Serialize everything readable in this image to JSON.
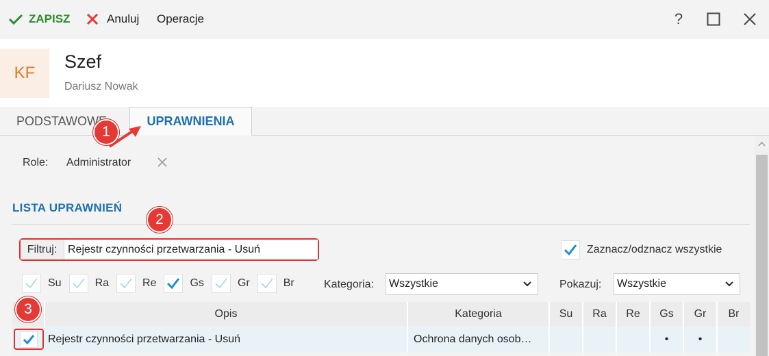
{
  "toolbar": {
    "save_label": "ZAPISZ",
    "cancel_label": "Anuluj",
    "operations_label": "Operacje"
  },
  "window": {
    "help": "?"
  },
  "header": {
    "initials": "KF",
    "title": "Szef",
    "name": "Dariusz Nowak"
  },
  "tabs": [
    {
      "label": "PODSTAWOWE"
    },
    {
      "label": "UPRAWNIENIA",
      "active": true
    }
  ],
  "roles": {
    "label": "Role:",
    "value": "Administrator"
  },
  "section": {
    "title": "LISTA UPRAWNIEŃ"
  },
  "filter": {
    "label": "Filtruj:",
    "value": "Rejestr czynności przetwarzania - Usuń"
  },
  "select_all": {
    "label": "Zaznacz/odznacz wszystkie",
    "checked": true
  },
  "flags": [
    {
      "label": "Su",
      "checked": false
    },
    {
      "label": "Ra",
      "checked": false
    },
    {
      "label": "Re",
      "checked": false
    },
    {
      "label": "Gs",
      "checked": true
    },
    {
      "label": "Gr",
      "checked": false
    },
    {
      "label": "Br",
      "checked": false
    }
  ],
  "category_filter": {
    "label": "Kategoria:",
    "value": "Wszystkie"
  },
  "show_filter": {
    "label": "Pokazuj:",
    "value": "Wszystkie"
  },
  "table": {
    "headers": [
      "Opis",
      "Kategoria",
      "Su",
      "Ra",
      "Re",
      "Gs",
      "Gr",
      "Br"
    ],
    "rows": [
      {
        "checked": true,
        "opis": "Rejestr czynności przetwarzania - Usuń",
        "kategoria": "Ochrona danych osob…",
        "su": "",
        "ra": "",
        "re": "",
        "gs": "•",
        "gr": "•",
        "br": ""
      }
    ]
  },
  "annotations": [
    "1",
    "2",
    "3"
  ],
  "colors": {
    "accent_blue": "#1f6fae",
    "save_green": "#2e8b2e",
    "cancel_red": "#e53935",
    "check_blue": "#1a8fd1",
    "annotation_red": "#e53935"
  }
}
